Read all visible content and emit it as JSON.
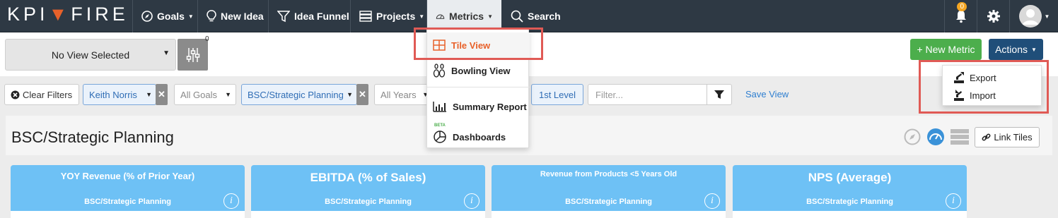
{
  "brand": {
    "left": "KPI",
    "right": "FIRE"
  },
  "nav": {
    "goals": "Goals",
    "new_idea": "New Idea",
    "idea_funnel": "Idea Funnel",
    "projects": "Projects",
    "metrics": "Metrics",
    "search": "Search",
    "notifications_count": "0"
  },
  "toolbar": {
    "view_select": "No View Selected",
    "filter_count": "0",
    "new_metric": "+ New Metric",
    "actions": "Actions"
  },
  "filters": {
    "clear": "Clear Filters",
    "person": "Keith Norris",
    "goals": "All Goals",
    "department": "BSC/Strategic Planning",
    "years": "All Years",
    "level": "1st Level",
    "filter_placeholder": "Filter...",
    "save_view": "Save View"
  },
  "page": {
    "title": "BSC/Strategic Planning",
    "link_tiles": "Link Tiles"
  },
  "metrics_menu": {
    "tile_view": "Tile View",
    "bowling_view": "Bowling View",
    "summary_report": "Summary Report",
    "beta": "BETA",
    "dashboards": "Dashboards"
  },
  "actions_menu": {
    "export": "Export",
    "import": "Import"
  },
  "tiles": [
    {
      "title": "YOY Revenue (% of Prior Year)",
      "subtitle": "BSC/Strategic Planning"
    },
    {
      "title": "EBITDA (% of Sales)",
      "subtitle": "BSC/Strategic Planning"
    },
    {
      "title": "Revenue from Products <5 Years Old",
      "subtitle": "BSC/Strategic Planning"
    },
    {
      "title": "NPS (Average)",
      "subtitle": "BSC/Strategic Planning"
    }
  ],
  "colors": {
    "nav_bg": "#2e3944",
    "accent_orange": "#e8612a",
    "tile_blue": "#6ec1f5",
    "green": "#4cae4c",
    "navy": "#1f4e79",
    "highlight_red": "#e05a55"
  }
}
